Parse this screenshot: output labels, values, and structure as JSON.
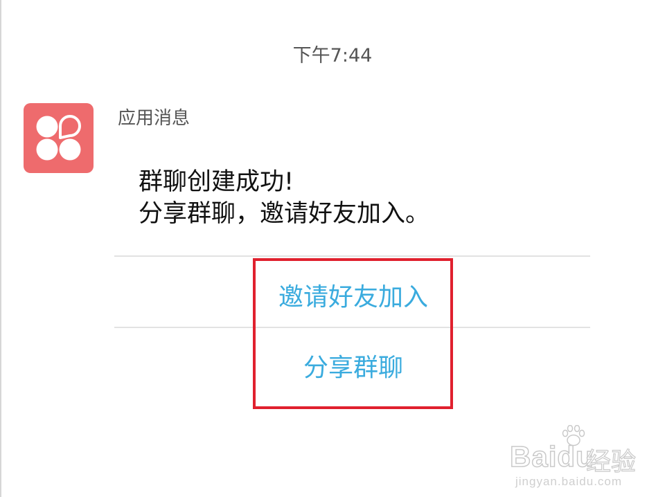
{
  "status": {
    "time": "下午7:44"
  },
  "notification": {
    "app_icon": "clover-app-icon",
    "sender": "应用消息",
    "message_lines": [
      "群聊创建成功!",
      "分享群聊，邀请好友加入。"
    ],
    "actions": [
      {
        "label": "邀请好友加入"
      },
      {
        "label": "分享群聊"
      }
    ]
  },
  "watermark": {
    "logo": "Baidu",
    "product": "经验",
    "url": "jingyan.baidu.com"
  },
  "colors": {
    "icon_background": "#ee6b6d",
    "action_text": "#3aabde",
    "highlight_border": "#e0202e",
    "divider": "#e2e2e2"
  }
}
